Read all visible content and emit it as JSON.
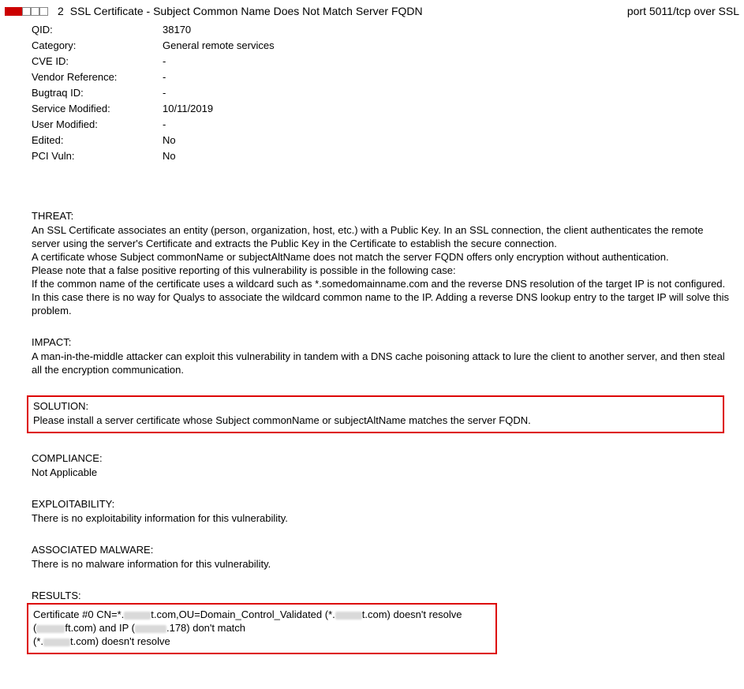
{
  "header": {
    "severity_level": "2",
    "severity_filled": 2,
    "severity_total": 5,
    "title": "SSL Certificate - Subject Common Name Does Not Match Server FQDN",
    "port_info": "port 5011/tcp over SSL"
  },
  "details": [
    {
      "label": "QID:",
      "value": "38170"
    },
    {
      "label": "Category:",
      "value": "General remote services"
    },
    {
      "label": "CVE ID:",
      "value": "-"
    },
    {
      "label": "Vendor Reference:",
      "value": "-"
    },
    {
      "label": "Bugtraq ID:",
      "value": "-"
    },
    {
      "label": "Service Modified:",
      "value": "10/11/2019"
    },
    {
      "label": "User Modified:",
      "value": "-"
    },
    {
      "label": "Edited:",
      "value": "No"
    },
    {
      "label": "PCI Vuln:",
      "value": "No"
    }
  ],
  "threat": {
    "heading": "THREAT:",
    "p1": "An SSL Certificate associates an entity (person, organization, host, etc.) with a Public Key. In an SSL connection, the client authenticates the remote server using the server's Certificate and extracts the Public Key in the Certificate to establish the secure connection.",
    "p2": "A certificate whose Subject commonName or subjectAltName does not match the server FQDN offers only encryption without authentication.",
    "p3": "Please note that a false positive reporting of this vulnerability is possible in the following case:",
    "p4": "If the common name of the certificate uses a wildcard such as *.somedomainname.com and the reverse DNS resolution of the target IP is not configured. In this case there is no way for Qualys to associate the wildcard common name to the IP. Adding a reverse DNS lookup entry to the target IP will solve this problem."
  },
  "impact": {
    "heading": "IMPACT:",
    "body": "A man-in-the-middle attacker can exploit this vulnerability in tandem with a DNS cache poisoning attack to lure the client to another server, and then steal all the encryption communication."
  },
  "solution": {
    "heading": "SOLUTION:",
    "body": "Please install a server certificate whose Subject commonName or subjectAltName matches the server FQDN."
  },
  "compliance": {
    "heading": "COMPLIANCE:",
    "body": "Not Applicable"
  },
  "exploitability": {
    "heading": "EXPLOITABILITY:",
    "body": "There is no exploitability information for this vulnerability."
  },
  "malware": {
    "heading": "ASSOCIATED MALWARE:",
    "body": "There is no malware information for this vulnerability."
  },
  "results": {
    "heading": "RESULTS:",
    "line1_a": "Certificate #0 CN=*.",
    "line1_b": "t.com,OU=Domain_Control_Validated (*.",
    "line1_c": "t.com) doesn't resolve",
    "line2_a": "(",
    "line2_b": "ft.com) and IP (",
    "line2_c": ".178) don't match",
    "line3_a": "(*.",
    "line3_b": "t.com) doesn't resolve"
  }
}
